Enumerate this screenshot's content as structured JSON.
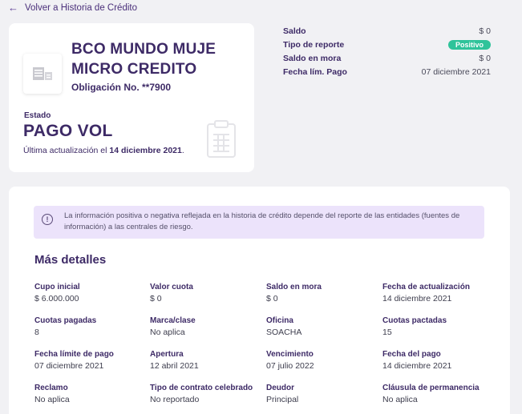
{
  "back_link": {
    "label": "Volver a Historia de Crédito"
  },
  "account": {
    "bank_name": "BCO MUNDO MUJE MICRO CREDITO",
    "obligation": "Obligación No. **7900",
    "estado_label": "Estado",
    "estado_value": "PAGO VOL",
    "updated_prefix": "Última actualización el",
    "updated_date": "14 diciembre 2021",
    "updated_suffix": "."
  },
  "summary": [
    {
      "label": "Saldo",
      "value": "$ 0"
    },
    {
      "label": "Tipo de reporte",
      "value": "Positivo",
      "badge": true
    },
    {
      "label": "Saldo en mora",
      "value": "$ 0"
    },
    {
      "label": "Fecha lím. Pago",
      "value": "07 diciembre 2021"
    }
  ],
  "info": {
    "text": "La información positiva o negativa reflejada en la historia de crédito depende del reporte de las entidades (fuentes de información) a las centrales de riesgo."
  },
  "details": {
    "title": "Más detalles",
    "items": [
      {
        "label": "Cupo inicial",
        "value": "$ 6.000.000"
      },
      {
        "label": "Valor cuota",
        "value": "$ 0"
      },
      {
        "label": "Saldo en mora",
        "value": "$ 0"
      },
      {
        "label": "Fecha de actualización",
        "value": "14 diciembre 2021"
      },
      {
        "label": "Cuotas pagadas",
        "value": "8"
      },
      {
        "label": "Marca/clase",
        "value": "No aplica"
      },
      {
        "label": "Oficina",
        "value": "SOACHA"
      },
      {
        "label": "Cuotas pactadas",
        "value": "15"
      },
      {
        "label": "Fecha límite de pago",
        "value": "07 diciembre 2021"
      },
      {
        "label": "Apertura",
        "value": "12 abril 2021"
      },
      {
        "label": "Vencimiento",
        "value": "07 julio 2022"
      },
      {
        "label": "Fecha del pago",
        "value": "14 diciembre 2021"
      },
      {
        "label": "Reclamo",
        "value": "No aplica"
      },
      {
        "label": "Tipo de contrato celebrado",
        "value": "No reportado"
      },
      {
        "label": "Deudor",
        "value": "Principal"
      },
      {
        "label": "Cláusula de permanencia",
        "value": "No aplica"
      }
    ]
  },
  "colors": {
    "primary": "#3d2a66",
    "badge": "#2fc39a",
    "info_bg": "#ece3fb",
    "page_bg": "#f1f1f4"
  },
  "icons": {
    "back": "arrow-left-icon",
    "logo": "bank-logo-icon",
    "clipboard": "clipboard-icon",
    "info": "info-icon"
  }
}
